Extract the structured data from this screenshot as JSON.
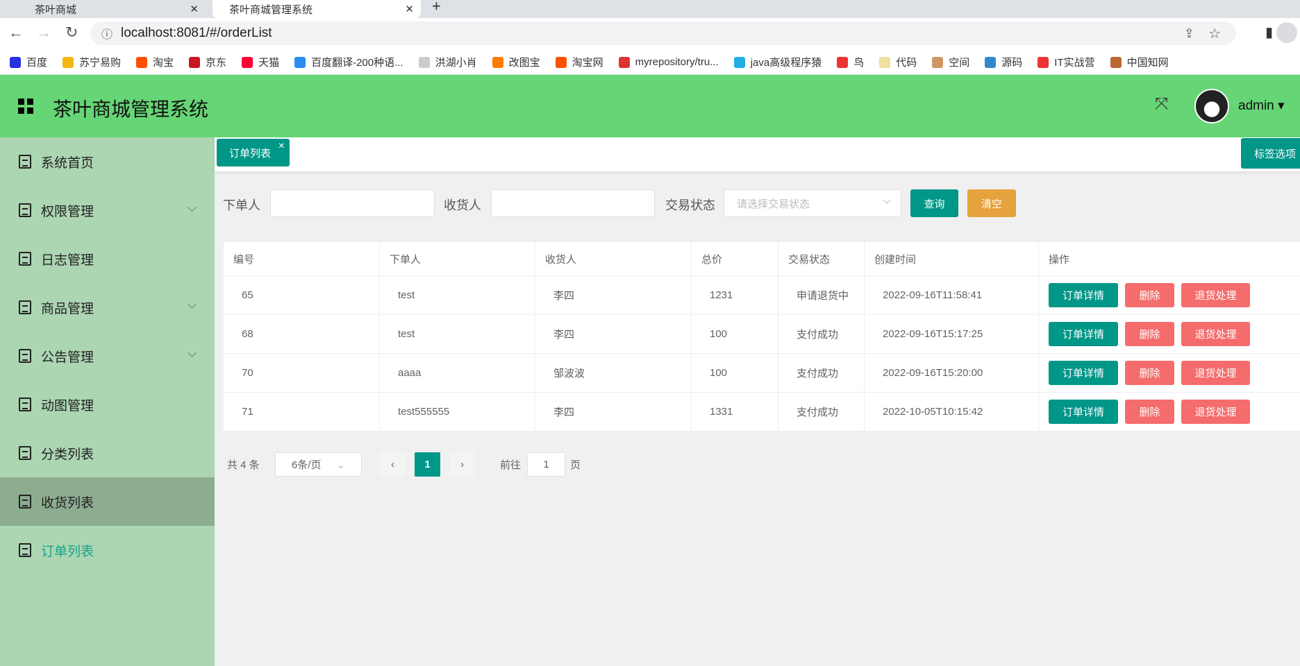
{
  "browser": {
    "tabs": [
      {
        "title": "茶叶商城"
      },
      {
        "title": "茶叶商城管理系统"
      }
    ],
    "url": "localhost:8081/#/orderList",
    "bookmarks": [
      {
        "label": "百度",
        "color": "#2932e1"
      },
      {
        "label": "苏宁易购",
        "color": "#f5b70f"
      },
      {
        "label": "淘宝",
        "color": "#ff5000"
      },
      {
        "label": "京东",
        "color": "#c91623"
      },
      {
        "label": "天猫",
        "color": "#ff0036"
      },
      {
        "label": "百度翻译-200种语...",
        "color": "#2b8cf0"
      },
      {
        "label": "洪湖小肖",
        "color": "#ccc"
      },
      {
        "label": "改图宝",
        "color": "#ff7b00"
      },
      {
        "label": "淘宝网",
        "color": "#ff5000"
      },
      {
        "label": "myrepository/tru...",
        "color": "#d33"
      },
      {
        "label": "java高级程序猿",
        "color": "#23ade5"
      },
      {
        "label": "鸟",
        "color": "#e33"
      },
      {
        "label": "代码",
        "color": "#eee0a0"
      },
      {
        "label": "空间",
        "color": "#c96"
      },
      {
        "label": "源码",
        "color": "#38c"
      },
      {
        "label": "IT实战营",
        "color": "#e33"
      },
      {
        "label": "中国知网",
        "color": "#b63"
      }
    ]
  },
  "header": {
    "title": "茶叶商城管理系统",
    "user": "admin"
  },
  "sidebar": {
    "items": [
      {
        "label": "系统首页"
      },
      {
        "label": "权限管理"
      },
      {
        "label": "日志管理"
      },
      {
        "label": "商品管理"
      },
      {
        "label": "公告管理"
      },
      {
        "label": "动图管理"
      },
      {
        "label": "分类列表"
      },
      {
        "label": "收货列表"
      },
      {
        "label": "订单列表"
      }
    ]
  },
  "tags": {
    "active": "订单列表",
    "close": "×",
    "options": "标签选项"
  },
  "filters": {
    "orderer_label": "下单人",
    "receiver_label": "收货人",
    "status_label": "交易状态",
    "status_placeholder": "请选择交易状态",
    "query": "查询",
    "clear": "清空"
  },
  "table": {
    "headers": [
      "编号",
      "下单人",
      "收货人",
      "总价",
      "交易状态",
      "创建时间",
      "操作"
    ],
    "rows": [
      [
        "65",
        "test",
        "李四",
        "1231",
        "申请退货中",
        "2022-09-16T11:58:41"
      ],
      [
        "68",
        "test",
        "李四",
        "100",
        "支付成功",
        "2022-09-16T15:17:25"
      ],
      [
        "70",
        "aaaa",
        "邹波波",
        "100",
        "支付成功",
        "2022-09-16T15:20:00"
      ],
      [
        "71",
        "test555555",
        "李四",
        "1331",
        "支付成功",
        "2022-10-05T10:15:42"
      ]
    ],
    "actions": {
      "detail": "订单详情",
      "delete": "删除",
      "refund": "退货处理"
    }
  },
  "pagination": {
    "total": "共 4 条",
    "page_size": "6条/页",
    "current": "1",
    "goto_label": "前往",
    "goto_value": "1",
    "page_suffix": "页"
  }
}
